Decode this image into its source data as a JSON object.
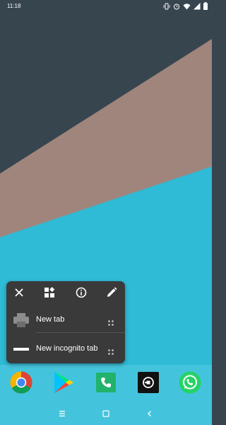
{
  "status_bar": {
    "time": "11:18",
    "icons": [
      "vibrate-icon",
      "alarm-icon",
      "wifi-icon",
      "signal-icon",
      "battery-icon"
    ]
  },
  "popup": {
    "toolbar": [
      "close-icon",
      "widgets-icon",
      "info-icon",
      "edit-icon"
    ],
    "shortcuts": [
      {
        "label": "New tab",
        "icon": "printer-tab-icon"
      },
      {
        "label": "New incognito tab",
        "icon": "incognito-icon"
      }
    ]
  },
  "dock": {
    "apps": [
      "chrome-icon",
      "play-store-icon",
      "phone-icon",
      "uber-icon",
      "whatsapp-icon"
    ]
  },
  "nav_bar": {
    "buttons": [
      "recents-icon",
      "home-icon",
      "back-icon"
    ]
  },
  "colors": {
    "wallpaper_dark": "#37454f",
    "wallpaper_taupe": "#a0857c",
    "wallpaper_cyan": "#2fbad6",
    "popup_bg": "#3a3a3a"
  }
}
